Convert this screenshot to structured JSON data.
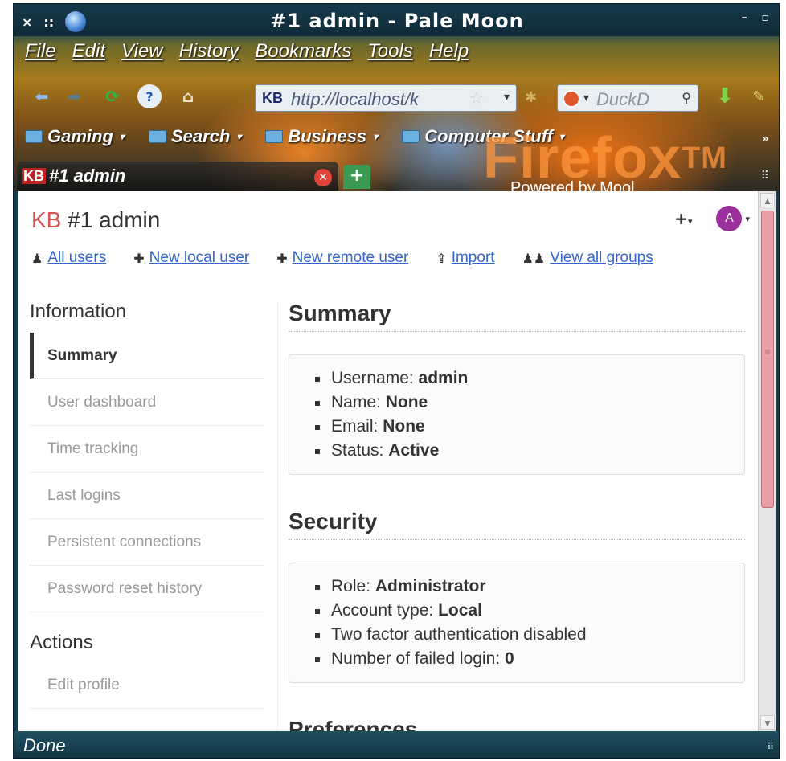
{
  "window": {
    "title": "#1 admin - Pale Moon",
    "controls": {
      "close": "×",
      "more": "::",
      "minimize": "–",
      "maximize": "▫"
    }
  },
  "menubar": [
    "File",
    "Edit",
    "View",
    "History",
    "Bookmarks",
    "Tools",
    "Help"
  ],
  "navbar": {
    "url_prefix": "KB",
    "url": "http://localhost/k",
    "search_placeholder": "DuckD"
  },
  "bookmarks": [
    "Gaming",
    "Search",
    "Business",
    "Computer Stuff"
  ],
  "branding": {
    "logo_text": "Firefox",
    "trademark": "TM",
    "tagline": "Powered by Mool"
  },
  "tab": {
    "favicon": "KB",
    "label": "#1 admin"
  },
  "page": {
    "header_kb": "KB",
    "header_title": "#1 admin",
    "avatar_letter": "A",
    "links": [
      "All users",
      "New local user",
      "New remote user",
      "Import",
      "View all groups"
    ]
  },
  "sidebar": {
    "information_heading": "Information",
    "items": [
      "Summary",
      "User dashboard",
      "Time tracking",
      "Last logins",
      "Persistent connections",
      "Password reset history"
    ],
    "actions_heading": "Actions",
    "action_items": [
      "Edit profile"
    ]
  },
  "summary": {
    "title": "Summary",
    "username_label": "Username:",
    "username": "admin",
    "name_label": "Name:",
    "name": "None",
    "email_label": "Email:",
    "email": "None",
    "status_label": "Status:",
    "status": "Active"
  },
  "security": {
    "title": "Security",
    "role_label": "Role:",
    "role": "Administrator",
    "account_type_label": "Account type:",
    "account_type": "Local",
    "two_factor": "Two factor authentication disabled",
    "failed_login_label": "Number of failed login:",
    "failed_login": "0"
  },
  "preferences": {
    "title": "Preferences"
  },
  "statusbar": {
    "text": "Done"
  },
  "colors": {
    "link": "#3366cc",
    "kb_accent": "#d9534f",
    "avatar": "#9b2f9b"
  }
}
